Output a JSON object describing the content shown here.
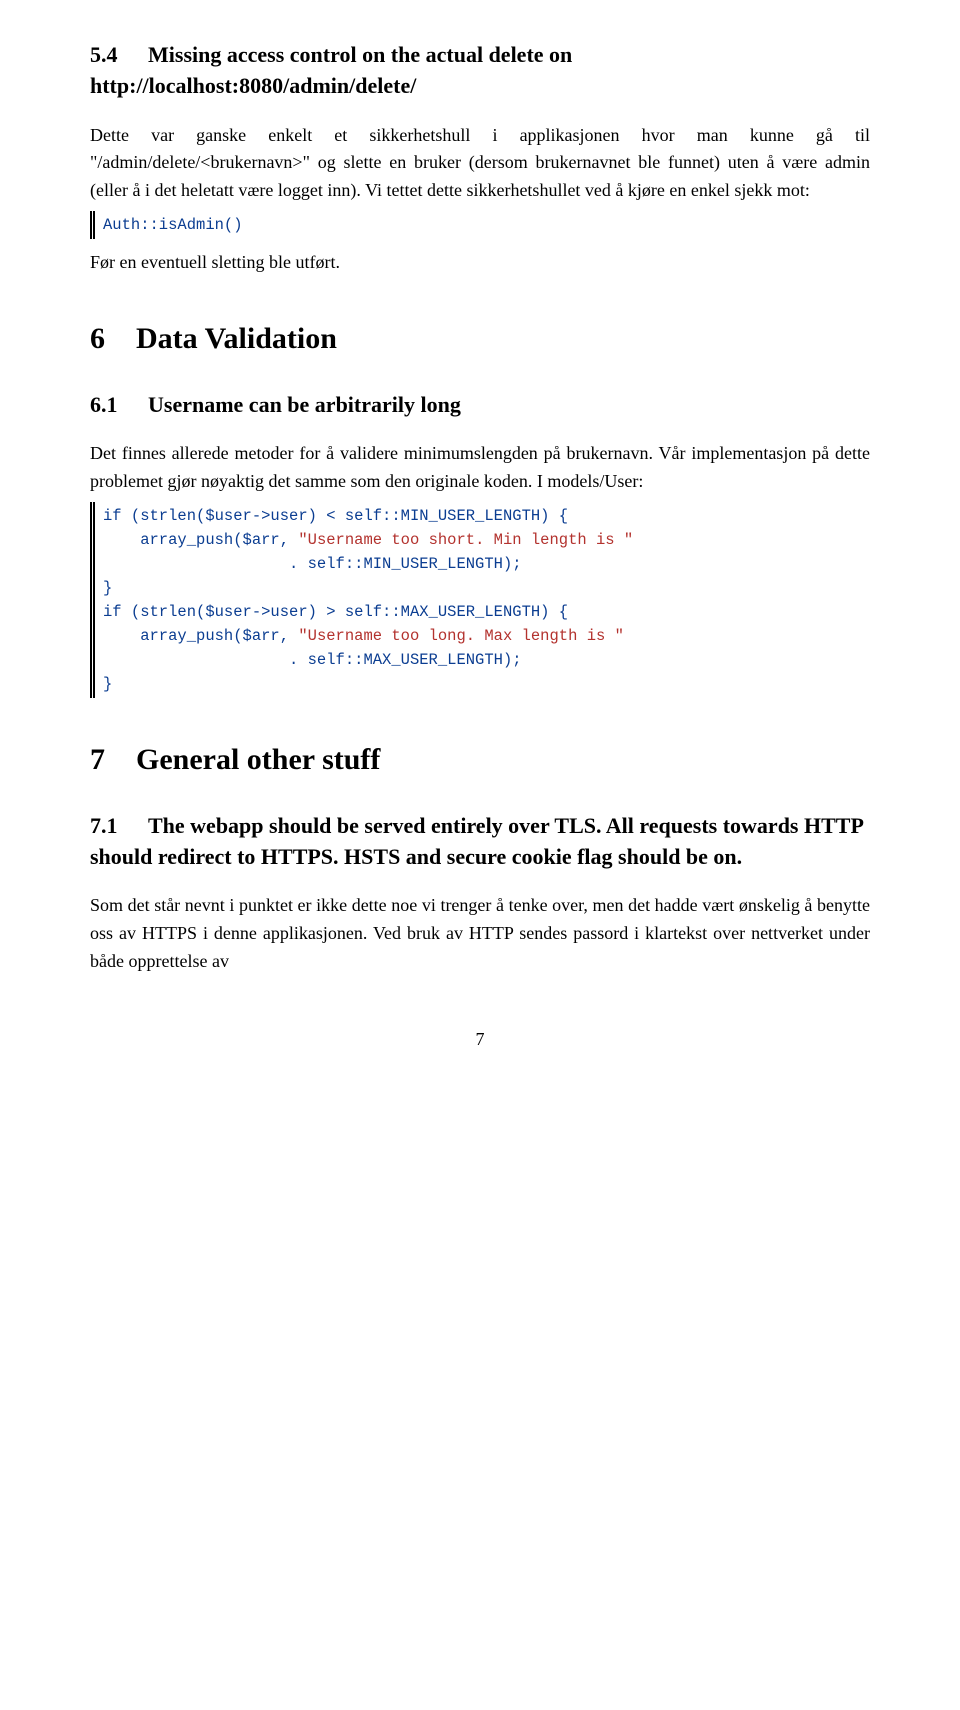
{
  "sec54": {
    "num": "5.4",
    "title": "Missing access control on the actual delete on http://localhost:8080/admin/delete/",
    "p1": "Dette var ganske enkelt et sikkerhetshull i applikasjonen hvor man kunne gå til \"/admin/delete/<brukernavn>\" og slette en bruker (dersom brukernavnet ble funnet) uten å være admin (eller å i det heletatt være logget inn). Vi tettet dette sikkerhetshullet ved å kjøre en enkel sjekk mot:",
    "code1": "Auth::isAdmin()",
    "p2": "Før en eventuell sletting ble utført."
  },
  "sec6": {
    "num": "6",
    "title": "Data Validation"
  },
  "sec61": {
    "num": "6.1",
    "title": "Username can be arbitrarily long",
    "p1": "Det finnes allerede metoder for å validere minimumslengden på brukernavn. Vår implementasjon på dette problemet gjør nøyaktig det samme som den originale koden. I models/User:",
    "code_l1a": "if (strlen($user->user) < self::MIN_USER_LENGTH) {",
    "code_l2a": "    array_push($arr, ",
    "code_l2b": "\"Username too short. Min length is \"",
    "code_l3a": "                    . self::MIN_USER_LENGTH);",
    "code_l4a": "}",
    "code_l5a": "if (strlen($user->user) > self::MAX_USER_LENGTH) {",
    "code_l6a": "    array_push($arr, ",
    "code_l6b": "\"Username too long. Max length is \"",
    "code_l7a": "                    . self::MAX_USER_LENGTH);",
    "code_l8a": "}"
  },
  "sec7": {
    "num": "7",
    "title": "General other stuff"
  },
  "sec71": {
    "num": "7.1",
    "title": "The webapp should be served entirely over TLS. All requests towards HTTP should redirect to HTTPS. HSTS and secure cookie flag should be on.",
    "p1": "Som det står nevnt i punktet er ikke dette noe vi trenger å tenke over, men det hadde vært ønskelig å benytte oss av HTTPS i denne applikasjonen. Ved bruk av HTTP sendes passord i klartekst over nettverket under både opprettelse av"
  },
  "page": "7"
}
